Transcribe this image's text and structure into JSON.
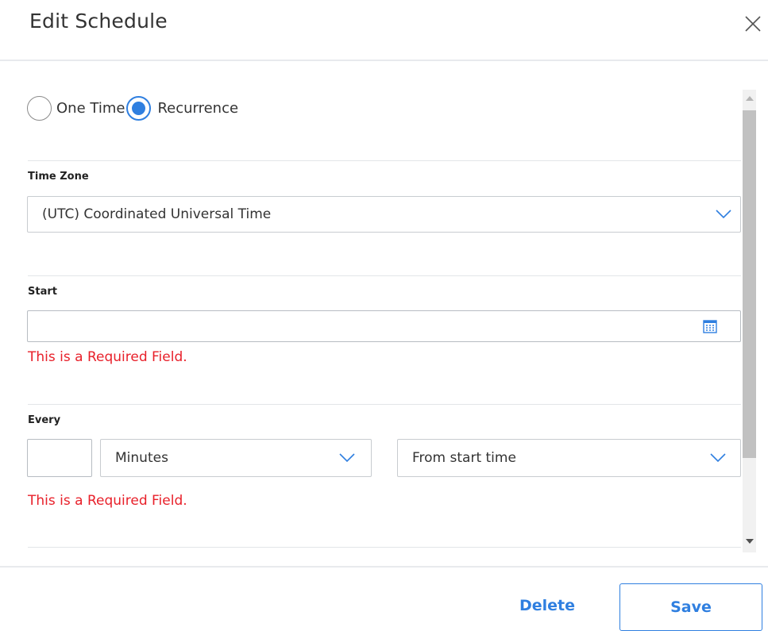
{
  "dialog": {
    "title": "Edit Schedule"
  },
  "schedule_type": {
    "options": [
      "One Time",
      "Recurrence"
    ],
    "selected": "Recurrence"
  },
  "time_zone": {
    "label": "Time Zone",
    "value": "(UTC) Coordinated Universal Time"
  },
  "start": {
    "label": "Start",
    "value": "",
    "error": "This is a Required Field."
  },
  "every": {
    "label": "Every",
    "interval_value": "",
    "unit": "Minutes",
    "reference": "From start time",
    "error": "This is a Required Field."
  },
  "footer": {
    "delete_label": "Delete",
    "save_label": "Save"
  },
  "colors": {
    "accent": "#2f7fe0",
    "error": "#e8202a"
  }
}
